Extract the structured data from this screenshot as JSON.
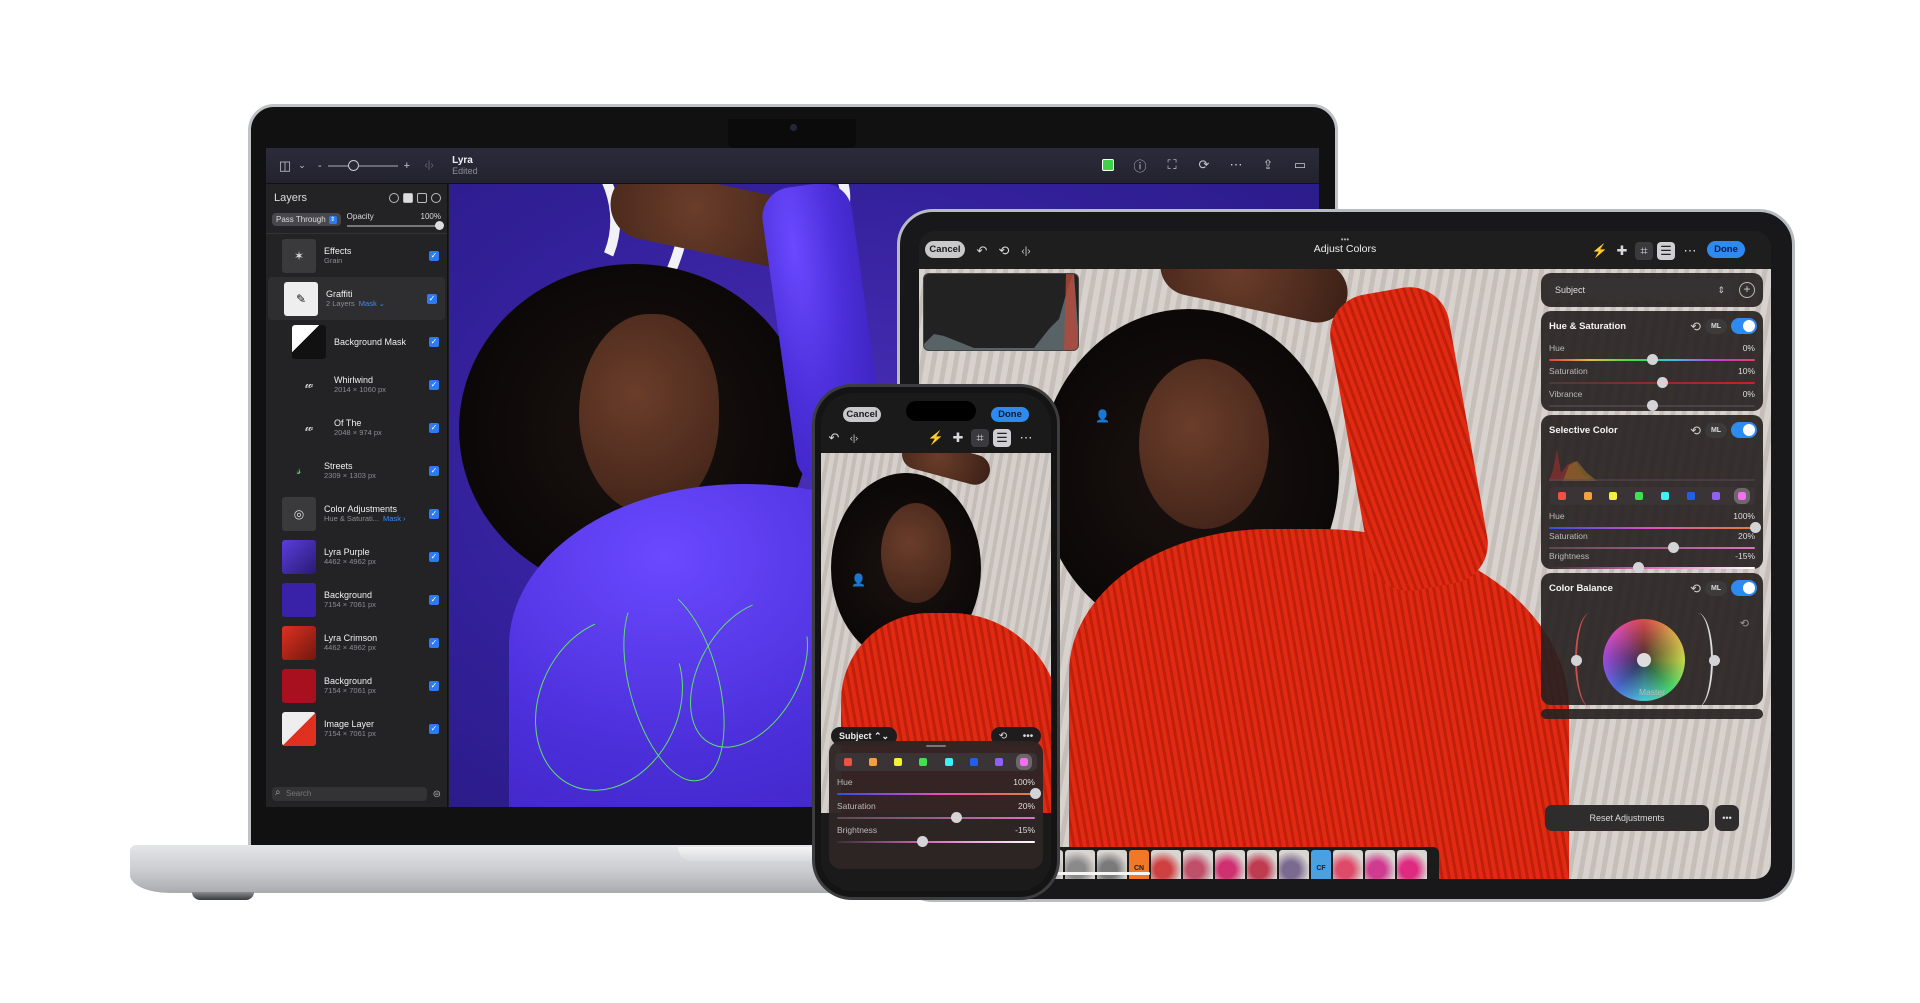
{
  "macbook": {
    "toolbar": {
      "doc_title": "Lyra",
      "doc_status": "Edited",
      "zoom_minus": "-",
      "zoom_plus": "+",
      "icons": [
        "sidebar-icon",
        "chevron-down-icon",
        "compare-icon",
        "color-picker-icon",
        "info-icon",
        "face-detect-icon",
        "rotate-icon",
        "more-icon",
        "share-icon",
        "inspector-icon"
      ]
    },
    "layers_panel": {
      "title": "Layers",
      "blend_mode": "Pass Through",
      "opacity_label": "Opacity",
      "opacity_value": "100%",
      "opacity_fraction": 1.0,
      "search_placeholder": "Search",
      "layers": [
        {
          "name": "Effects",
          "sub": "Grain",
          "mask": "",
          "thumb": "effects",
          "checked": true
        },
        {
          "name": "Graffiti",
          "sub": "2 Layers",
          "mask": "Mask ⌄",
          "thumb": "graffiti",
          "checked": true
        },
        {
          "name": "Background Mask",
          "sub": "",
          "mask": "",
          "thumb": "mask",
          "checked": true
        },
        {
          "name": "Whirlwind",
          "sub": "2014 × 1060 px",
          "mask": "",
          "thumb": "script",
          "checked": true
        },
        {
          "name": "Of The",
          "sub": "2048 × 974 px",
          "mask": "",
          "thumb": "script",
          "checked": true
        },
        {
          "name": "Streets",
          "sub": "2309 × 1303 px",
          "mask": "",
          "thumb": "streets",
          "checked": true
        },
        {
          "name": "Color Adjustments",
          "sub": "Hue & Saturati...",
          "mask": "Mask ›",
          "thumb": "adjust",
          "checked": true
        },
        {
          "name": "Lyra Purple",
          "sub": "4462 × 4962 px",
          "mask": "",
          "thumb": "purple-photo",
          "checked": true
        },
        {
          "name": "Background",
          "sub": "7154 × 7061 px",
          "mask": "",
          "thumb": "purple-fill",
          "checked": true
        },
        {
          "name": "Lyra Crimson",
          "sub": "4462 × 4962 px",
          "mask": "",
          "thumb": "crimson-photo",
          "checked": true
        },
        {
          "name": "Background",
          "sub": "7154 × 7061 px",
          "mask": "",
          "thumb": "crimson-fill",
          "checked": true
        },
        {
          "name": "Image Layer",
          "sub": "7154 × 7061 px",
          "mask": "",
          "thumb": "image",
          "checked": true
        }
      ]
    }
  },
  "ipad": {
    "toolbar": {
      "cancel_label": "Cancel",
      "done_label": "Done",
      "title": "Adjust Colors",
      "title_dots": "•••",
      "left_icons": [
        "undo-icon",
        "reset-icon",
        "compare-icon"
      ],
      "right_icons": [
        "ml-magic-wand-icon",
        "bandage-icon",
        "crop-icon",
        "adjustments-icon",
        "more-icon"
      ]
    },
    "panel": {
      "selector_value": "Subject",
      "hue_saturation": {
        "title": "Hue & Saturation",
        "ml_label": "ML",
        "enabled": true,
        "sliders": [
          {
            "label": "Hue",
            "value": "0%",
            "position": 0.5
          },
          {
            "label": "Saturation",
            "value": "10%",
            "position": 0.55
          },
          {
            "label": "Vibrance",
            "value": "0%",
            "position": 0.5
          }
        ]
      },
      "selective_color": {
        "title": "Selective Color",
        "ml_label": "ML",
        "enabled": true,
        "swatches": [
          "#f25040",
          "#f5a040",
          "#f5f040",
          "#40e050",
          "#40f0f5",
          "#2060e8",
          "#9060f0",
          "#f070f0"
        ],
        "active_swatch": 7,
        "sliders": [
          {
            "label": "Hue",
            "value": "100%",
            "position": 1.0
          },
          {
            "label": "Saturation",
            "value": "20%",
            "position": 0.6
          },
          {
            "label": "Brightness",
            "value": "-15%",
            "position": 0.43
          }
        ]
      },
      "color_balance": {
        "title": "Color Balance",
        "ml_label": "ML",
        "enabled": true,
        "wheel_label": "Master"
      },
      "reset_label": "Reset Adjustments",
      "more_label": "•••"
    },
    "filmstrip": {
      "tags": [
        {
          "label": "CN",
          "color": "#f07828"
        },
        {
          "label": "CF",
          "color": "#4aa0e0"
        }
      ]
    }
  },
  "iphone": {
    "cancel_label": "Cancel",
    "done_label": "Done",
    "subject_label": "Subject ⌃⌄",
    "more_label": "•••",
    "swatches": [
      "#f25040",
      "#f5a040",
      "#f5f040",
      "#40e050",
      "#40f0f5",
      "#2060e8",
      "#9060f0",
      "#f070f0"
    ],
    "active_swatch": 7,
    "sliders": [
      {
        "label": "Hue",
        "value": "100%",
        "position": 1.0
      },
      {
        "label": "Saturation",
        "value": "20%",
        "position": 0.6
      },
      {
        "label": "Brightness",
        "value": "-15%",
        "position": 0.43
      }
    ]
  },
  "colors": {
    "accent_blue": "#2d8bf0",
    "panel_dark": "#232325",
    "canvas_purple": "#3a22a8",
    "sweater_red": "#e02a12"
  }
}
